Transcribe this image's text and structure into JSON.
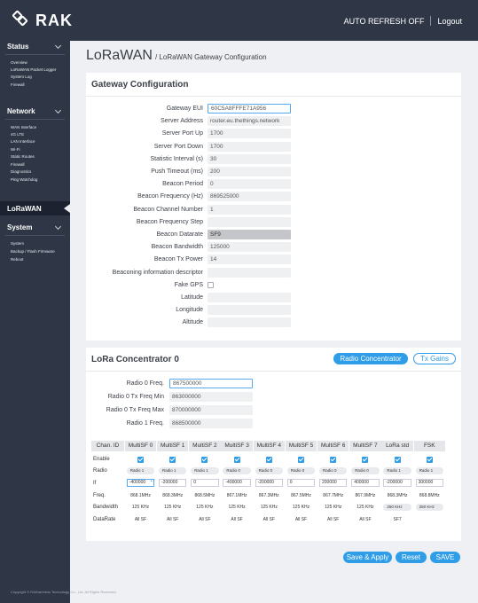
{
  "header": {
    "logo_text": "RAK",
    "auto_refresh_label": "AUTO REFRESH OFF",
    "logout_label": "Logout"
  },
  "sidebar": {
    "sections": [
      {
        "title": "Status",
        "items": [
          "Overview",
          "LoRaWAN Packet Logger",
          "System Log",
          "Firewall"
        ]
      },
      {
        "title": "Network",
        "items": [
          "WAN Interface",
          "4G LTE",
          "LAN Interface",
          "Wi-Fi",
          "Static Routes",
          "Firewall",
          "Diagnostics",
          "Ping Watchdog"
        ]
      },
      {
        "title": "LoRaWAN",
        "items": []
      },
      {
        "title": "System",
        "items": [
          "System",
          "Backup / Flash Firmware",
          "Reboot"
        ]
      }
    ]
  },
  "page": {
    "title": "LoRaWAN",
    "breadcrumb": "/ LoRaWAN Gateway Configuration"
  },
  "gateway_config": {
    "title": "Gateway Configuration",
    "fields": [
      {
        "label": "Gateway EUI",
        "value": "60C5A8FFFE71A956"
      },
      {
        "label": "Server Address",
        "value": "router.eu.thethings.network"
      },
      {
        "label": "Server Port Up",
        "value": "1700"
      },
      {
        "label": "Server Port Down",
        "value": "1700"
      },
      {
        "label": "Statistic Interval (s)",
        "value": "30"
      },
      {
        "label": "Push Timeout (ms)",
        "value": "200"
      },
      {
        "label": "Beacon Period",
        "value": "0"
      },
      {
        "label": "Beacon Frequency (Hz)",
        "value": "869525000"
      },
      {
        "label": "Beacon Channel Number",
        "value": "1"
      },
      {
        "label": "Beacon Frequency Step",
        "value": ""
      },
      {
        "label": "Beacon Datarate",
        "value": "SF9"
      },
      {
        "label": "Beacon Bandwidth",
        "value": "125000"
      },
      {
        "label": "Beacon Tx Power",
        "value": "14"
      },
      {
        "label": "Beaconing information descriptor",
        "value": ""
      },
      {
        "label": "Fake GPS",
        "value": ""
      },
      {
        "label": "Latitude",
        "value": ""
      },
      {
        "label": "Longitude",
        "value": ""
      },
      {
        "label": "Altitude",
        "value": ""
      }
    ]
  },
  "lora_concentrator": {
    "title": "LoRa Concentrator 0",
    "radio_concentrator_button": "Radio Concentrator",
    "tx_gains_button": "Tx Gains",
    "fields": [
      {
        "label": "Radio 0 Freq.",
        "value": "867500000"
      },
      {
        "label": "Radio 0 Tx Freq Min",
        "value": "863000000"
      },
      {
        "label": "Radio 0 Tx Freq Max",
        "value": "870000000"
      },
      {
        "label": "Radio 1 Freq.",
        "value": "868500000"
      }
    ],
    "table": {
      "row_labels": [
        "Enable",
        "Radio",
        "If",
        "Freq.",
        "Bandwidth",
        "DataRate"
      ],
      "header_first": "Chan. ID",
      "columns": [
        {
          "name": "MultiSF 0",
          "radio": "Radio 1",
          "if": "-400000",
          "freq": "868.1MHz",
          "bw": "125 KHz",
          "dr": "All SF"
        },
        {
          "name": "MultiSF 1",
          "radio": "Radio 1",
          "if": "-200000",
          "freq": "868.3MHz",
          "bw": "125 KHz",
          "dr": "All SF"
        },
        {
          "name": "MultiSF 2",
          "radio": "Radio 1",
          "if": "0",
          "freq": "868.5MHz",
          "bw": "125 KHz",
          "dr": "All SF"
        },
        {
          "name": "MultiSF 3",
          "radio": "Radio 0",
          "if": "-400000",
          "freq": "867.1MHz",
          "bw": "125 KHz",
          "dr": "All SF"
        },
        {
          "name": "MultiSF 4",
          "radio": "Radio 0",
          "if": "-200000",
          "freq": "867.3MHz",
          "bw": "125 KHz",
          "dr": "All SF"
        },
        {
          "name": "MultiSF 5",
          "radio": "Radio 0",
          "if": "0",
          "freq": "867.5MHz",
          "bw": "125 KHz",
          "dr": "All SF"
        },
        {
          "name": "MultiSF 6",
          "radio": "Radio 0",
          "if": "200000",
          "freq": "867.7MHz",
          "bw": "125 KHz",
          "dr": "All SF"
        },
        {
          "name": "MultiSF 7",
          "radio": "Radio 0",
          "if": "400000",
          "freq": "867.9MHz",
          "bw": "125 KHz",
          "dr": "All SF"
        },
        {
          "name": "LoRa std",
          "radio": "Radio 1",
          "if": "-200000",
          "freq": "868.3MHz",
          "bw": "250 KHz",
          "dr": "SF7"
        },
        {
          "name": "FSK",
          "radio": "Radio 1",
          "if": "300000",
          "freq": "868.8MHz",
          "bw": "250 KHz",
          "dr": ""
        }
      ]
    }
  },
  "actions": {
    "save_apply": "Save & Apply",
    "reset": "Reset",
    "save": "SAVE"
  },
  "footer": "Copyright © RAKwireless Technology Co., Ltd. All Rights Reserved.",
  "colors": {
    "accent": "#2f9de8",
    "sidebar": "#2f3747"
  }
}
